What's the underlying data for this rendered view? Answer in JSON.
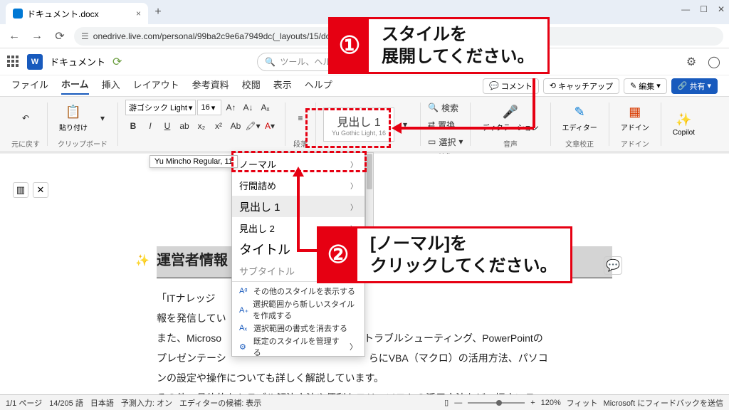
{
  "browser": {
    "tab_title": "ドキュメント.docx",
    "url": "onedrive.live.com/personal/99ba2c9e6a7949dc(_layouts/15/doc",
    "new_tab": "+",
    "window": {
      "min": "—",
      "max": "☐",
      "close": "✕"
    }
  },
  "word": {
    "logo_letter": "W",
    "doc_name": "ドキュメント",
    "search_placeholder": "ツール、ヘルプなど"
  },
  "ribbon_tabs": [
    "ファイル",
    "ホーム",
    "挿入",
    "レイアウト",
    "参考資料",
    "校閲",
    "表示",
    "ヘルプ"
  ],
  "ribbon_right": {
    "comment": "コメント",
    "catchup": "キャッチアップ",
    "edit": "編集",
    "share": "共有"
  },
  "ribbon": {
    "undo": "元に戻す",
    "clipboard": {
      "paste": "貼り付け",
      "label": "クリップボード"
    },
    "font": {
      "name": "游ゴシック Light",
      "size": "16",
      "buttons": [
        "B",
        "I",
        "U",
        "ab",
        "x₂",
        "x²",
        "Ab"
      ],
      "label": "段落"
    },
    "style_preview": {
      "main": "見出し 1",
      "sub": "Yu Gothic Light, 16"
    },
    "find": {
      "search": "検索",
      "replace": "置換",
      "select": "選択",
      "label": "編集"
    },
    "dictation": "ディクテーション",
    "voice": "音声",
    "editor": "エディター",
    "proof": "文章校正",
    "addins": "アドイン",
    "copilot": "Copilot"
  },
  "tooltip": "Yu Mincho Regular, 11",
  "style_panel": {
    "items": [
      {
        "label": "ノーマル",
        "chev": true
      },
      {
        "label": "行間詰め",
        "chev": true
      },
      {
        "label": "見出し 1",
        "chev": true,
        "h1": true
      },
      {
        "label": "見出し 2",
        "chev": true
      },
      {
        "label": "タイトル",
        "chev": true,
        "title": true
      },
      {
        "label": "サブタイトル",
        "chev": false,
        "sub": true
      }
    ],
    "actions": [
      "その他のスタイルを表示する",
      "選択範囲から新しいスタイルを作成する",
      "選択範囲の書式を消去する",
      "既定のスタイルを管理する"
    ]
  },
  "document": {
    "heading": "運営者情報",
    "p1a": "「ITナレッジ",
    "p1b": "報を発信してい",
    "p2a": "また、Microso",
    "p2b": "トラブルシューティング、PowerPointの",
    "p3a": "プレゼンテーシ",
    "p3b": "らにVBA（マクロ）の活用方法、パソコ",
    "p4": "ンの設定や操作についても詳しく解説しています。",
    "p5": "その他、具体的なトラブル解決方法や便利なフリーソフトの活用方法など、幅広いテーマ"
  },
  "status": {
    "page": "1/1 ページ",
    "words": "14/205 語",
    "lang": "日本語",
    "predict": "予測入力: オン",
    "editor": "エディターの候補: 表示",
    "zoom": "120%",
    "fit": "フィット",
    "feedback": "Microsoft にフィードバックを送信"
  },
  "callouts": {
    "c1_num": "①",
    "c1_l1": "スタイルを",
    "c1_l2": "展開してください。",
    "c2_num": "②",
    "c2_l1": "[ノーマル]を",
    "c2_l2": "クリックしてください。"
  }
}
